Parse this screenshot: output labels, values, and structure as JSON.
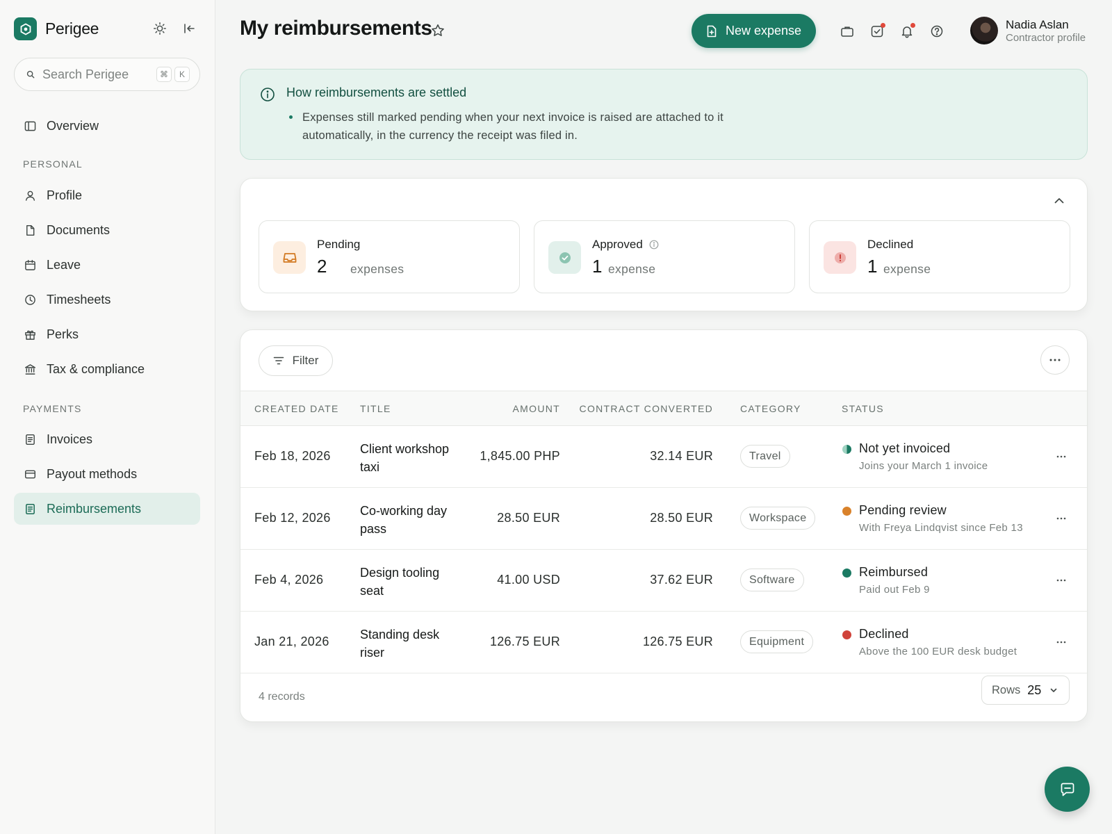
{
  "app": {
    "name": "Perigee"
  },
  "search": {
    "placeholder": "Search Perigee",
    "kbd_cmd": "⌘",
    "kbd_key": "K"
  },
  "nav": {
    "overview": "Overview",
    "personal_section": "PERSONAL",
    "personal": [
      "Profile",
      "Documents",
      "Leave",
      "Timesheets",
      "Perks",
      "Tax & compliance"
    ],
    "payments_section": "PAYMENTS",
    "payments": [
      "Invoices",
      "Payout methods",
      "Reimbursements"
    ],
    "active": "Reimbursements"
  },
  "header": {
    "title": "My reimbursements",
    "new_button": "New expense",
    "user_name": "Nadia Aslan",
    "user_role": "Contractor profile"
  },
  "banner": {
    "title": "How reimbursements are settled",
    "text": "Expenses still marked pending when your next invoice is raised are attached to it automatically, in the currency the receipt was filed in."
  },
  "summary": {
    "pending": {
      "label": "Pending",
      "count": "2",
      "unit": "expenses"
    },
    "approved": {
      "label": "Approved",
      "count": "1",
      "unit": "expense"
    },
    "declined": {
      "label": "Declined",
      "count": "1",
      "unit": "expense"
    }
  },
  "table": {
    "filter_label": "Filter",
    "columns": [
      "CREATED DATE",
      "TITLE",
      "AMOUNT",
      "CONTRACT CONVERTED",
      "CATEGORY",
      "STATUS"
    ],
    "rows": [
      {
        "date": "Feb 18, 2026",
        "title": "Client workshop taxi",
        "amount": "1,845.00 PHP",
        "converted": "32.14 EUR",
        "category": "Travel",
        "status": "Not yet invoiced",
        "status_detail": "Joins your March 1 invoice",
        "status_color": "half"
      },
      {
        "date": "Feb 12, 2026",
        "title": "Co-working day pass",
        "amount": "28.50 EUR",
        "converted": "28.50 EUR",
        "category": "Workspace",
        "status": "Pending review",
        "status_detail": "With Freya Lindqvist since Feb 13",
        "status_color": "#d9822b"
      },
      {
        "date": "Feb 4, 2026",
        "title": "Design tooling seat",
        "amount": "41.00 USD",
        "converted": "37.62 EUR",
        "category": "Software",
        "status": "Reimbursed",
        "status_detail": "Paid out Feb 9",
        "status_color": "#1b7a63"
      },
      {
        "date": "Jan 21, 2026",
        "title": "Standing desk riser",
        "amount": "126.75 EUR",
        "converted": "126.75 EUR",
        "category": "Equipment",
        "status": "Declined",
        "status_detail": "Above the 100 EUR desk budget",
        "status_color": "#d0433a"
      }
    ],
    "records": "4 records",
    "rows_label": "Rows",
    "rows_value": "25"
  },
  "colors": {
    "accent": "#1b7a63",
    "banner_bg": "#e6f3ee",
    "alert": "#e0493b"
  }
}
